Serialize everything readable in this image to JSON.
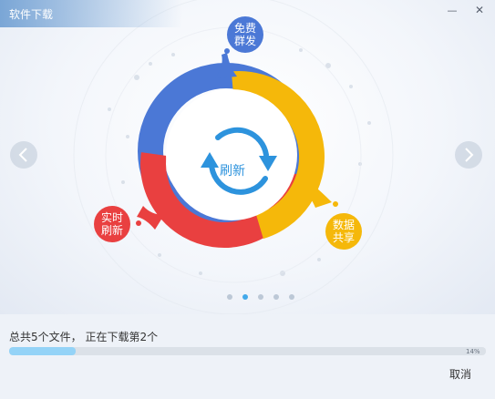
{
  "window": {
    "title": "软件下载",
    "minimize_glyph": "—",
    "close_glyph": "✕"
  },
  "carousel": {
    "center_label": "刷新",
    "bubbles": {
      "free": {
        "line1": "免费",
        "line2": "群发"
      },
      "realtime": {
        "line1": "实时",
        "line2": "刷新"
      },
      "share": {
        "line1": "数据",
        "line2": "共享"
      }
    },
    "page_count": 5,
    "active_page": 2,
    "prev_icon": "chevron-left-icon",
    "next_icon": "chevron-right-icon"
  },
  "download": {
    "status": "总共5个文件， 正在下载第2个",
    "progress_percent": 14,
    "progress_label": "14%",
    "cancel_label": "取消"
  },
  "colors": {
    "blue": "#4b78d6",
    "red": "#e94040",
    "yellow": "#f5b80a",
    "accent": "#42a9ea",
    "progress": "#94d3f7"
  }
}
